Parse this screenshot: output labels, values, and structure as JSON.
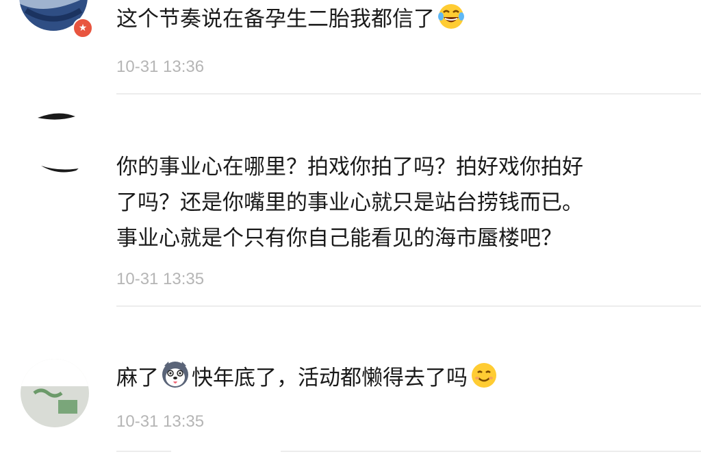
{
  "comments": [
    {
      "text": "这个节奏说在备孕生二胎我都信了",
      "emoji_after": "laughing-tears-icon",
      "time": "10-31 13:36"
    },
    {
      "lines": [
        "你的事业心在哪里？拍戏你拍了吗？拍好戏你拍好",
        "了吗？还是你嘴里的事业心就只是站台捞钱而已。",
        "事业心就是个只有你自己能看见的海市蜃楼吧？"
      ],
      "time": "10-31 13:35"
    },
    {
      "text_before": "麻了",
      "emoji_mid": "husky-dog-icon",
      "text_after": "快年底了，活动都懒得去了吗",
      "emoji_after": "smiling-face-icon",
      "time": "10-31 13:35"
    }
  ],
  "colors": {
    "text": "#1a1a1a",
    "time": "#b5b5b5",
    "divider": "#ececec",
    "badge": "#e8553f"
  }
}
